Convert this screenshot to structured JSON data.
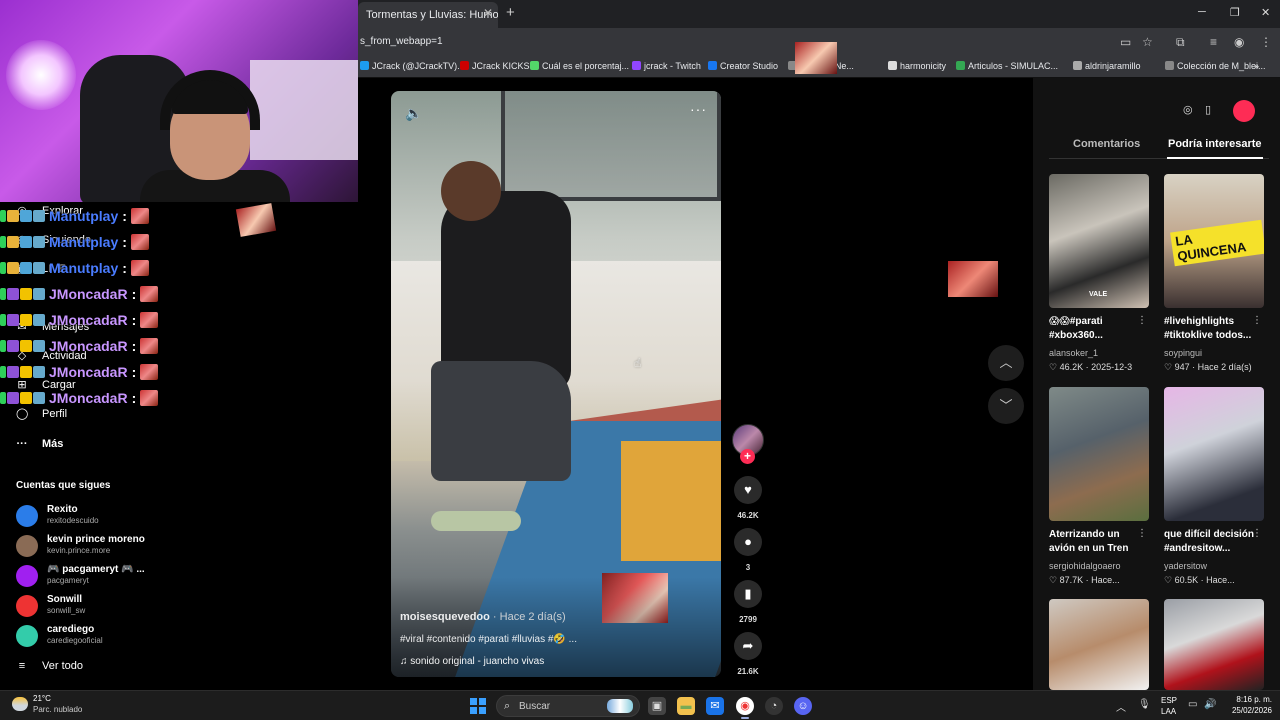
{
  "browser": {
    "tab_title": "Tormentas y Lluvias: Humor",
    "url": "s_from_webapp=1",
    "bookmarks": [
      {
        "label": "JCrack (@JCrackTV)...",
        "color": "#1d9bf0"
      },
      {
        "label": "JCrack KICKS",
        "color": "#c00"
      },
      {
        "label": "Cuál es el porcentaj...",
        "color": "#53d769"
      },
      {
        "label": "jcrack - Twitch",
        "color": "#9146ff"
      },
      {
        "label": "Creator Studio",
        "color": "#1877f2"
      },
      {
        "label": "Meta | A Ne...",
        "color": "#888"
      },
      {
        "label": "harmonicity",
        "color": "#ddd"
      },
      {
        "label": "Articulos - SIMULAC...",
        "color": "#34a853"
      },
      {
        "label": "aldrinjaramillo",
        "color": "#aaa"
      },
      {
        "label": "Colección de M_blei...",
        "color": "#888"
      }
    ],
    "more_bookmarks": "»",
    "window_controls": {
      "minimize": "─",
      "restore": "❐",
      "close": "✕"
    }
  },
  "sidebar": {
    "nav": [
      {
        "icon": "compass-icon",
        "glyph": "◎",
        "label": "Explorar"
      },
      {
        "icon": "following-icon",
        "glyph": "◉",
        "label": "Siguiendo"
      },
      {
        "icon": "live-icon",
        "glyph": "▣",
        "label": "LIVE"
      },
      {
        "icon": "messages-icon",
        "glyph": "✉",
        "label": "Mensajes"
      },
      {
        "icon": "activity-icon",
        "glyph": "◇",
        "label": "Actividad"
      },
      {
        "icon": "upload-icon",
        "glyph": "⊞",
        "label": "Cargar"
      },
      {
        "icon": "profile-icon",
        "glyph": "◯",
        "label": "Perfil"
      },
      {
        "icon": "more-icon",
        "glyph": "···",
        "label": "Más"
      }
    ],
    "following_title": "Cuentas que sigues",
    "accounts": [
      {
        "name": "Rexito",
        "handle": "rexitodescuido",
        "color": "#2b7de9"
      },
      {
        "name": "kevin prince moreno",
        "handle": "kevin.prince.more",
        "color": "#8a6b55"
      },
      {
        "name": "🎮 pacgameryt 🎮 ...",
        "handle": "pacgameryt",
        "color": "#a020f0"
      },
      {
        "name": "Sonwill",
        "handle": "sonwill_sw",
        "color": "#e33"
      },
      {
        "name": "carediego",
        "handle": "carediegooficial",
        "color": "#3ca"
      }
    ],
    "see_all": "Ver todo"
  },
  "chat": [
    {
      "user": "Manutplay",
      "color": "#4a7cff"
    },
    {
      "user": "Manutplay",
      "color": "#4a7cff"
    },
    {
      "user": "Manutplay",
      "color": "#4a7cff"
    },
    {
      "user": "JMoncadaR",
      "color": "#c896ff"
    },
    {
      "user": "JMoncadaR",
      "color": "#c896ff"
    },
    {
      "user": "JMoncadaR",
      "color": "#c896ff"
    },
    {
      "user": "JMoncadaR",
      "color": "#c896ff"
    },
    {
      "user": "JMoncadaR",
      "color": "#c896ff"
    }
  ],
  "chat_separator": ":",
  "video": {
    "author": "moisesquevedoo",
    "time": "· Hace 2 día(s)",
    "description": "#viral #contenido #parati #lluvias #🤣 ...",
    "sound": "sonido original - juancho vivas",
    "likes": "46.2K",
    "comments": "3",
    "saves": "2799",
    "shares": "21.6K"
  },
  "right_panel": {
    "tabs": [
      "Comentarios",
      "Podría interesarte"
    ],
    "cards": [
      {
        "title": "😱😱#parati #xbox360...",
        "author": "alansoker_1",
        "stats": "♡ 46.2K · 2025-12-3",
        "thumb_text": "",
        "thumb_label": "VALE",
        "bg": "linear-gradient(160deg,#6b6a63 0%,#c9c4bb 40%,#2a2a2a 70%,#d0c2b4 100%)"
      },
      {
        "title": "#livehighlights #tiktoklive todos...",
        "author": "soypingui",
        "stats": "♡ 947 · Hace 2 día(s)",
        "thumb_text": "LA QUINCENA",
        "thumb_label": "",
        "bg": "linear-gradient(180deg,#d8d2c4 0%,#bfa48a 50%,#3a3030 100%)"
      },
      {
        "title": "Aterrizando un avión en un Tren",
        "author": "sergiohidalgoaero",
        "stats": "♡ 87.7K · Hace...",
        "thumb_text": "",
        "thumb_label": "",
        "bg": "linear-gradient(160deg,#7f8a88 0%,#56616a 40%,#8d6c4f 70%,#5a6f3f 100%)"
      },
      {
        "title": "que difícil decisión #andresitow...",
        "author": "yadersitow",
        "stats": "♡ 60.5K · Hace...",
        "thumb_text": "",
        "thumb_label": "",
        "bg": "linear-gradient(160deg,#e6b6e6 0%,#cfd2da 40%,#2b2e3a 80%)"
      },
      {
        "title": "",
        "author": "",
        "stats": "",
        "thumb_text": "",
        "thumb_label": "",
        "bg": "linear-gradient(160deg,#cfc9c2 0%,#b78c6b 50%,#f2f2f2 100%)"
      },
      {
        "title": "",
        "author": "",
        "stats": "",
        "thumb_text": "",
        "thumb_label": "",
        "bg": "linear-gradient(160deg,#9a9ea5 0%,#d9d9d9 40%,#b0121b 70%,#222 100%)"
      }
    ],
    "card_menu": "⋮"
  },
  "taskbar": {
    "temp": "21°C",
    "weather": "Parc. nublado",
    "search": "Buscar",
    "lang1": "ESP",
    "lang2": "LAA",
    "time": "8:16 p. m.",
    "date": "25/02/2026"
  }
}
